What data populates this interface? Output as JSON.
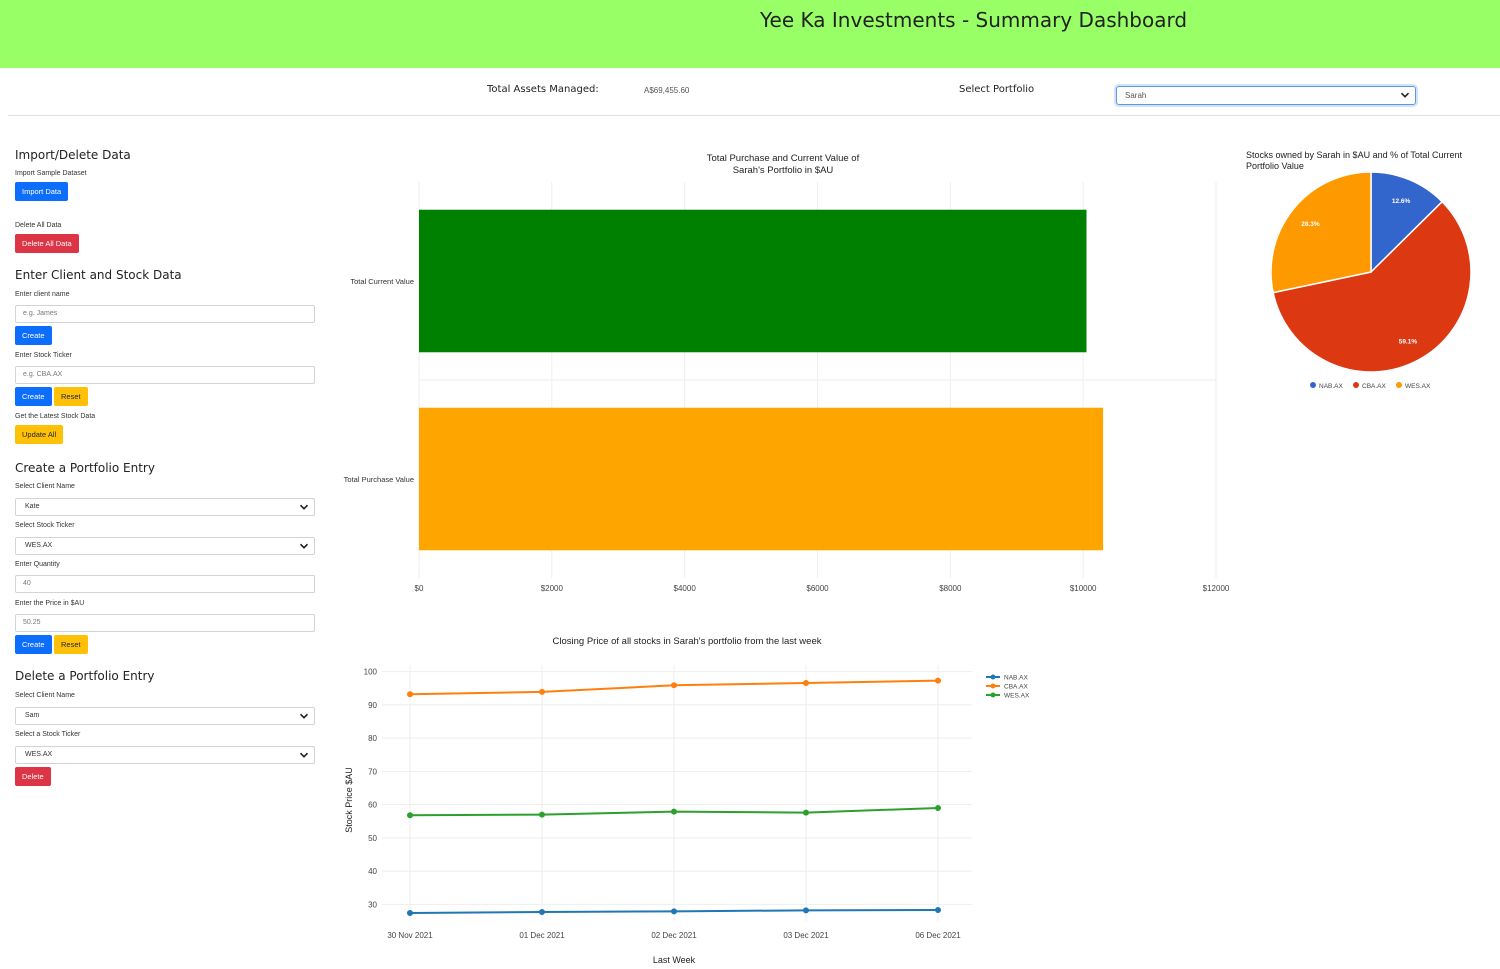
{
  "header": {
    "title": "Yee Ka Investments - Summary Dashboard"
  },
  "summary": {
    "total_assets_label": "Total Assets Managed:",
    "total_assets_value": "A$69,455.60",
    "select_portfolio_label": "Select Portfolio",
    "select_portfolio_value": "Sarah"
  },
  "sidebar": {
    "import_heading": "Import/Delete Data",
    "import_sample_label": "Import Sample Dataset",
    "import_button": "Import Data",
    "delete_all_label": "Delete All Data",
    "delete_all_button": "Delete All Data",
    "client_stock_heading": "Enter Client and Stock Data",
    "client_name_label": "Enter client name",
    "client_name_placeholder": "e.g. James",
    "client_create_button": "Create",
    "ticker_label": "Enter Stock Ticker",
    "ticker_placeholder": "e.g. CBA.AX",
    "ticker_create_button": "Create",
    "ticker_reset_button": "Reset",
    "latest_label": "Get the Latest Stock Data",
    "update_all_button": "Update All",
    "portfolio_entry_heading": "Create a Portfolio Entry",
    "select_client_label": "Select Client Name",
    "select_client_value": "Kate",
    "select_ticker_label": "Select Stock Ticker",
    "select_ticker_value": "WES.AX",
    "quantity_label": "Enter Quantity",
    "quantity_value": "40",
    "price_label": "Enter the Price in $AU",
    "price_value": "50.25",
    "entry_create_button": "Create",
    "entry_reset_button": "Reset",
    "delete_entry_heading": "Delete a Portfolio Entry",
    "delete_client_label": "Select Client Name",
    "delete_client_value": "Sam",
    "delete_ticker_label": "Select a Stock Ticker",
    "delete_ticker_value": "WES.AX",
    "delete_button": "Delete"
  },
  "chart_data": [
    {
      "type": "bar",
      "orientation": "horizontal",
      "title_lines": [
        "Total Purchase and Current Value of",
        "Sarah's Portfolio in $AU"
      ],
      "categories": [
        "Total Current Value",
        "Total Purchase Value"
      ],
      "values": [
        10050,
        10300
      ],
      "colors": [
        "#008000",
        "#ffa500"
      ],
      "xlim": [
        0,
        12000
      ],
      "xticks": [
        0,
        2000,
        4000,
        6000,
        8000,
        10000,
        12000
      ],
      "xtick_labels": [
        "$0",
        "$2000",
        "$4000",
        "$6000",
        "$8000",
        "$10000",
        "$12000"
      ],
      "grid": true
    },
    {
      "type": "pie",
      "title_lines": [
        "Stocks owned by Sarah in $AU and % of Total Current",
        "Portfolio Value"
      ],
      "categories": [
        "NAB.AX",
        "CBA.AX",
        "WES.AX"
      ],
      "values": [
        12.6,
        59.1,
        28.3
      ],
      "labels": [
        "12.6%",
        "59.1%",
        "28.3%"
      ],
      "colors": [
        "#3366cc",
        "#dc3912",
        "#ff9900"
      ],
      "legend": "bottom"
    },
    {
      "type": "line",
      "title": "Closing Price of all stocks in Sarah's portfolio from the last week",
      "xlabel": "Last Week",
      "ylabel": "Stock Price $AU",
      "x": [
        "30 Nov 2021",
        "01 Dec 2021",
        "02 Dec 2021",
        "03 Dec 2021",
        "06 Dec 2021"
      ],
      "ylim": [
        25,
        102
      ],
      "yticks": [
        30,
        40,
        50,
        60,
        70,
        80,
        90,
        100
      ],
      "series": [
        {
          "name": "NAB.AX",
          "color": "#1f77b4",
          "values": [
            27.4,
            27.7,
            27.9,
            28.2,
            28.3
          ]
        },
        {
          "name": "CBA.AX",
          "color": "#ff7f0e",
          "values": [
            93.2,
            93.9,
            95.9,
            96.6,
            97.3
          ]
        },
        {
          "name": "WES.AX",
          "color": "#2ca02c",
          "values": [
            56.8,
            57.0,
            57.9,
            57.6,
            59.0
          ]
        }
      ],
      "legend": "right",
      "grid": true
    }
  ]
}
